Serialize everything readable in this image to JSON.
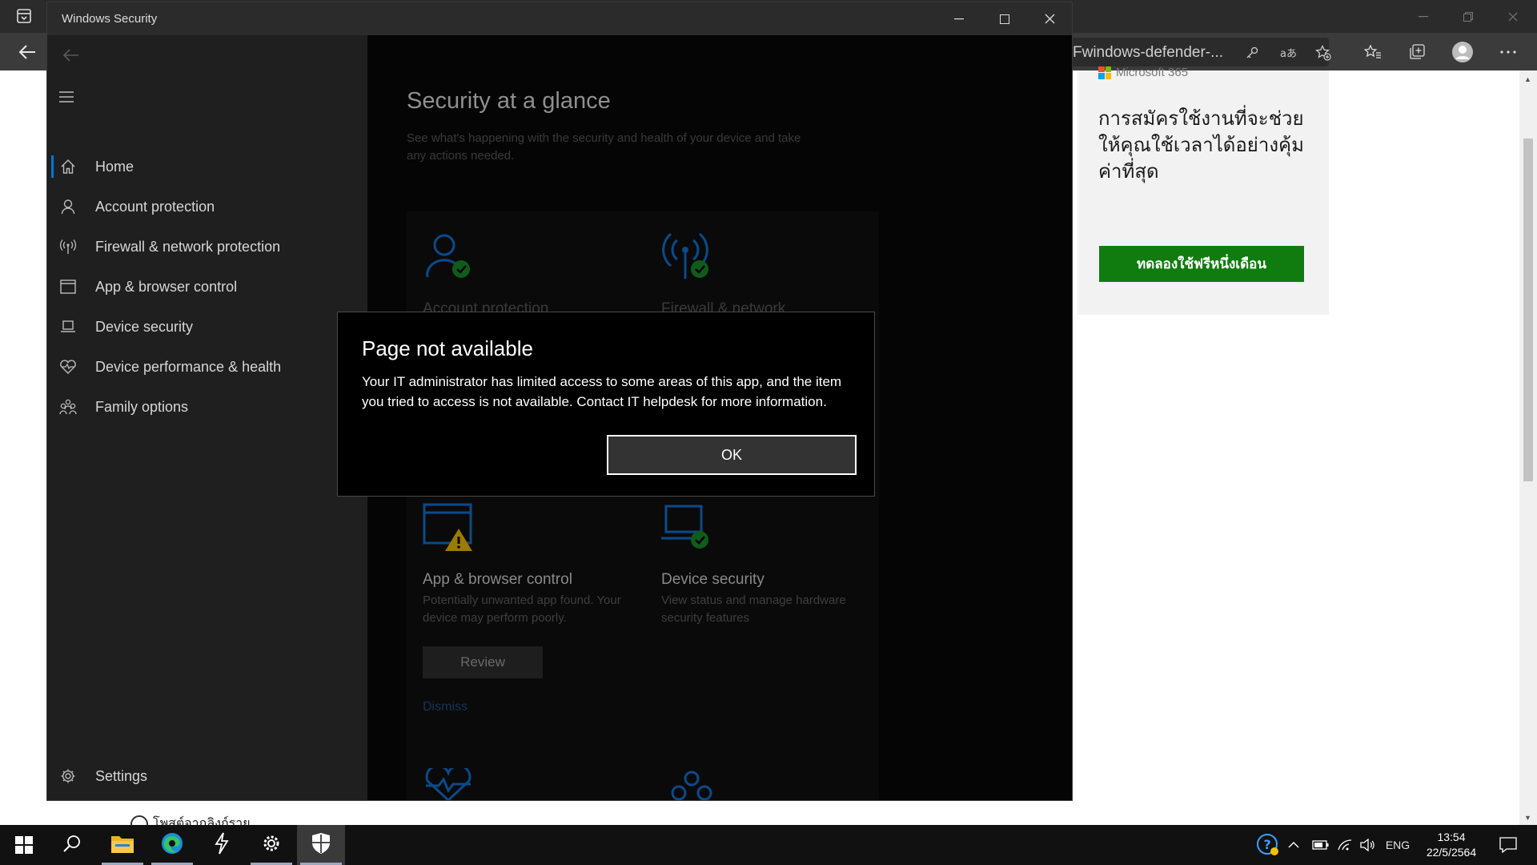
{
  "browser": {
    "address_text": "Fwindows-defender-...",
    "ad": {
      "brand": "Microsoft 365",
      "text": "การสมัครใช้งานที่จะช่วยให้คุณใช้เวลาได้อย่างคุ้มค่าที่สุด",
      "button": "ทดลองใช้ฟรีหนึ่งเดือน"
    },
    "page_fragment": "โพสต์จากลิงก์ราย"
  },
  "window": {
    "title": "Windows Security"
  },
  "sidebar": {
    "items": [
      {
        "label": "Home",
        "icon": "home-icon"
      },
      {
        "label": "Account protection",
        "icon": "person-icon"
      },
      {
        "label": "Firewall & network protection",
        "icon": "antenna-icon"
      },
      {
        "label": "App & browser control",
        "icon": "browser-window-icon"
      },
      {
        "label": "Device security",
        "icon": "laptop-icon"
      },
      {
        "label": "Device performance & health",
        "icon": "heart-icon"
      },
      {
        "label": "Family options",
        "icon": "family-icon"
      }
    ],
    "settings": "Settings"
  },
  "main": {
    "heading": "Security at a glance",
    "subtitle": "See what's happening with the security and health of your device and take any actions needed.",
    "cards": {
      "account": "Account protection",
      "firewall": "Firewall & network",
      "app_browser": {
        "title": "App & browser control",
        "desc": "Potentially unwanted app found. Your device may perform poorly.",
        "button": "Review",
        "link": "Dismiss"
      },
      "device_security": {
        "title": "Device security",
        "desc": "View status and manage hardware security features"
      }
    }
  },
  "dialog": {
    "title": "Page not available",
    "message": "Your IT administrator has limited access to some areas of this app, and the item you tried to access is not available. Contact IT helpdesk for more information.",
    "ok": "OK"
  },
  "taskbar": {
    "language": "ENG",
    "time": "13:54",
    "date": "22/5/2564"
  },
  "colors": {
    "accent": "#0078d4",
    "ok_green": "#107c10",
    "warning": "#c7a000"
  }
}
